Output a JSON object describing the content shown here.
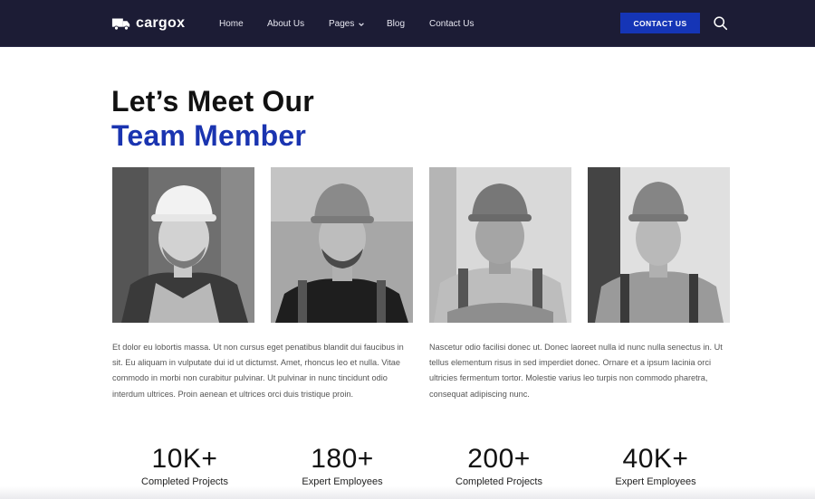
{
  "header": {
    "brand": "cargox",
    "nav": [
      {
        "label": "Home"
      },
      {
        "label": "About Us"
      },
      {
        "label": "Pages"
      },
      {
        "label": "Blog"
      },
      {
        "label": "Contact Us"
      }
    ],
    "contact_button": "CONTACT US",
    "search_icon": "search-icon",
    "logo_icon": "truck-icon"
  },
  "section": {
    "title_line1": "Let’s Meet Our",
    "title_line2": "Team Member",
    "accent_color": "#1a34b0",
    "photos": [
      {
        "name": "team-photo-1"
      },
      {
        "name": "team-photo-2"
      },
      {
        "name": "team-photo-3"
      },
      {
        "name": "team-photo-4"
      }
    ],
    "paragraph_left": "Et dolor eu lobortis massa. Ut non cursus eget penatibus blandit dui faucibus in sit. Eu aliquam in vulputate dui id ut dictumst. Amet, rhoncus leo et nulla. Vitae commodo in morbi non curabitur pulvinar. Ut pulvinar in nunc tincidunt odio interdum ultrices. Proin aenean et ultrices orci duis tristique proin.",
    "paragraph_right": "Nascetur odio facilisi donec ut. Donec laoreet nulla id nunc nulla senectus in. Ut tellus elementum risus in sed imperdiet donec. Ornare et a ipsum lacinia orci ultricies fermentum tortor. Molestie varius leo turpis non commodo pharetra, consequat adipiscing nunc."
  },
  "stats": [
    {
      "value": "10K+",
      "label": "Completed Projects"
    },
    {
      "value": "180+",
      "label": "Expert Employees"
    },
    {
      "value": "200+",
      "label": "Completed Projects"
    },
    {
      "value": "40K+",
      "label": "Expert Employees"
    }
  ],
  "colors": {
    "header_bg": "#1c1c35",
    "button_bg": "#1535b6"
  }
}
